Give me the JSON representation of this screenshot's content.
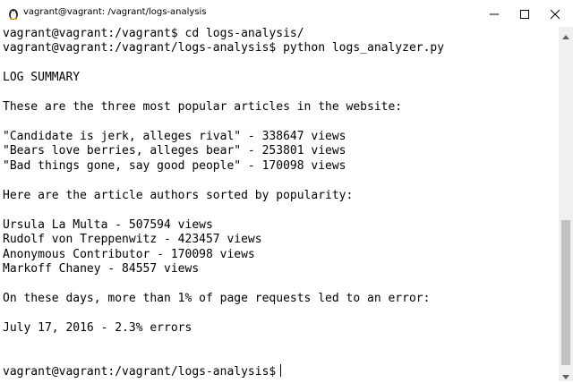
{
  "window": {
    "title": "vagrant@vagrant: /vagrant/logs-analysis",
    "app_icon": "terminal-penguin-icon",
    "controls": {
      "minimize_icon": "minimize-icon",
      "maximize_icon": "maximize-icon",
      "close_icon": "close-icon"
    }
  },
  "terminal": {
    "lines": [
      "vagrant@vagrant:/vagrant$ cd logs-analysis/",
      "vagrant@vagrant:/vagrant/logs-analysis$ python logs_analyzer.py",
      "",
      "LOG SUMMARY",
      "",
      "These are the three most popular articles in the website:",
      "",
      "\"Candidate is jerk, alleges rival\" - 338647 views",
      "\"Bears love berries, alleges bear\" - 253801 views",
      "\"Bad things gone, say good people\" - 170098 views",
      "",
      "Here are the article authors sorted by popularity:",
      "",
      "Ursula La Multa - 507594 views",
      "Rudolf von Treppenwitz - 423457 views",
      "Anonymous Contributor - 170098 views",
      "Markoff Chaney - 84557 views",
      "",
      "On these days, more than 1% of page requests led to an error:",
      "",
      "July 17, 2016 - 2.3% errors",
      "",
      "",
      "vagrant@vagrant:/vagrant/logs-analysis$"
    ]
  },
  "scrollbar": {
    "up_icon": "scroll-up-arrow-icon",
    "down_icon": "scroll-down-arrow-icon"
  }
}
